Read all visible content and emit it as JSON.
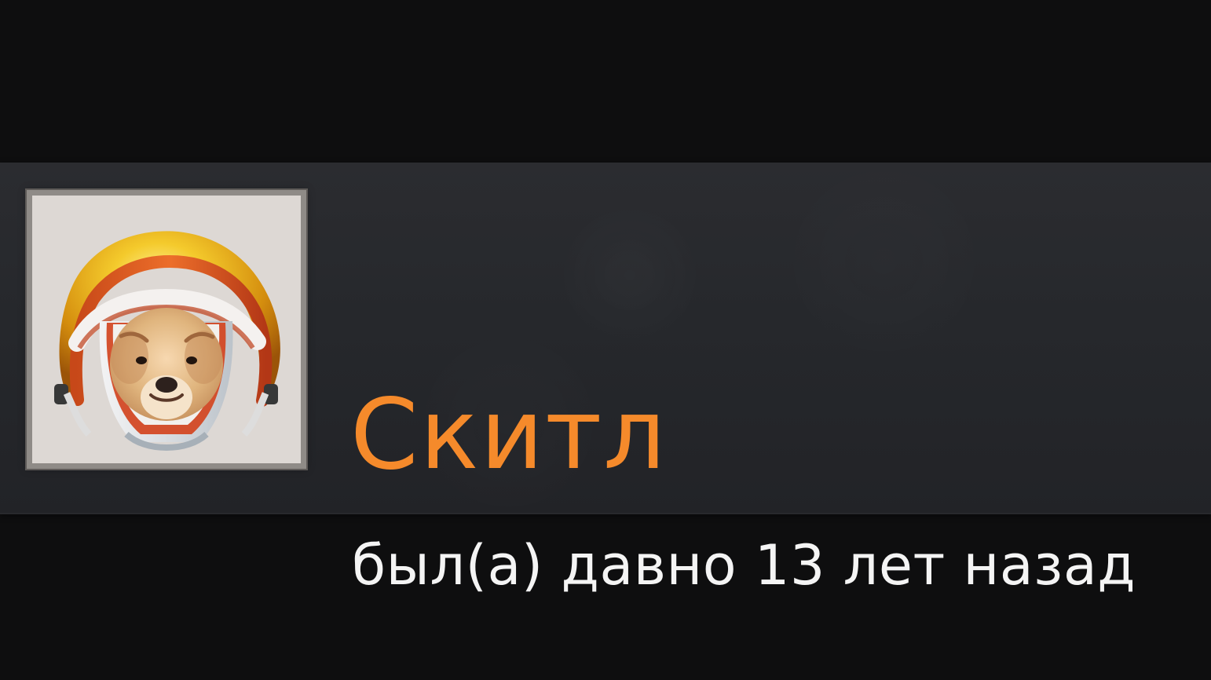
{
  "profile": {
    "name": "Скитл",
    "status": "был(а) давно 13 лет назад",
    "avatar_icon": "dog-astronaut-avatar",
    "accent_color": "#f58a2b",
    "text_color": "#f4f4f4",
    "background_color": "#26282c"
  }
}
